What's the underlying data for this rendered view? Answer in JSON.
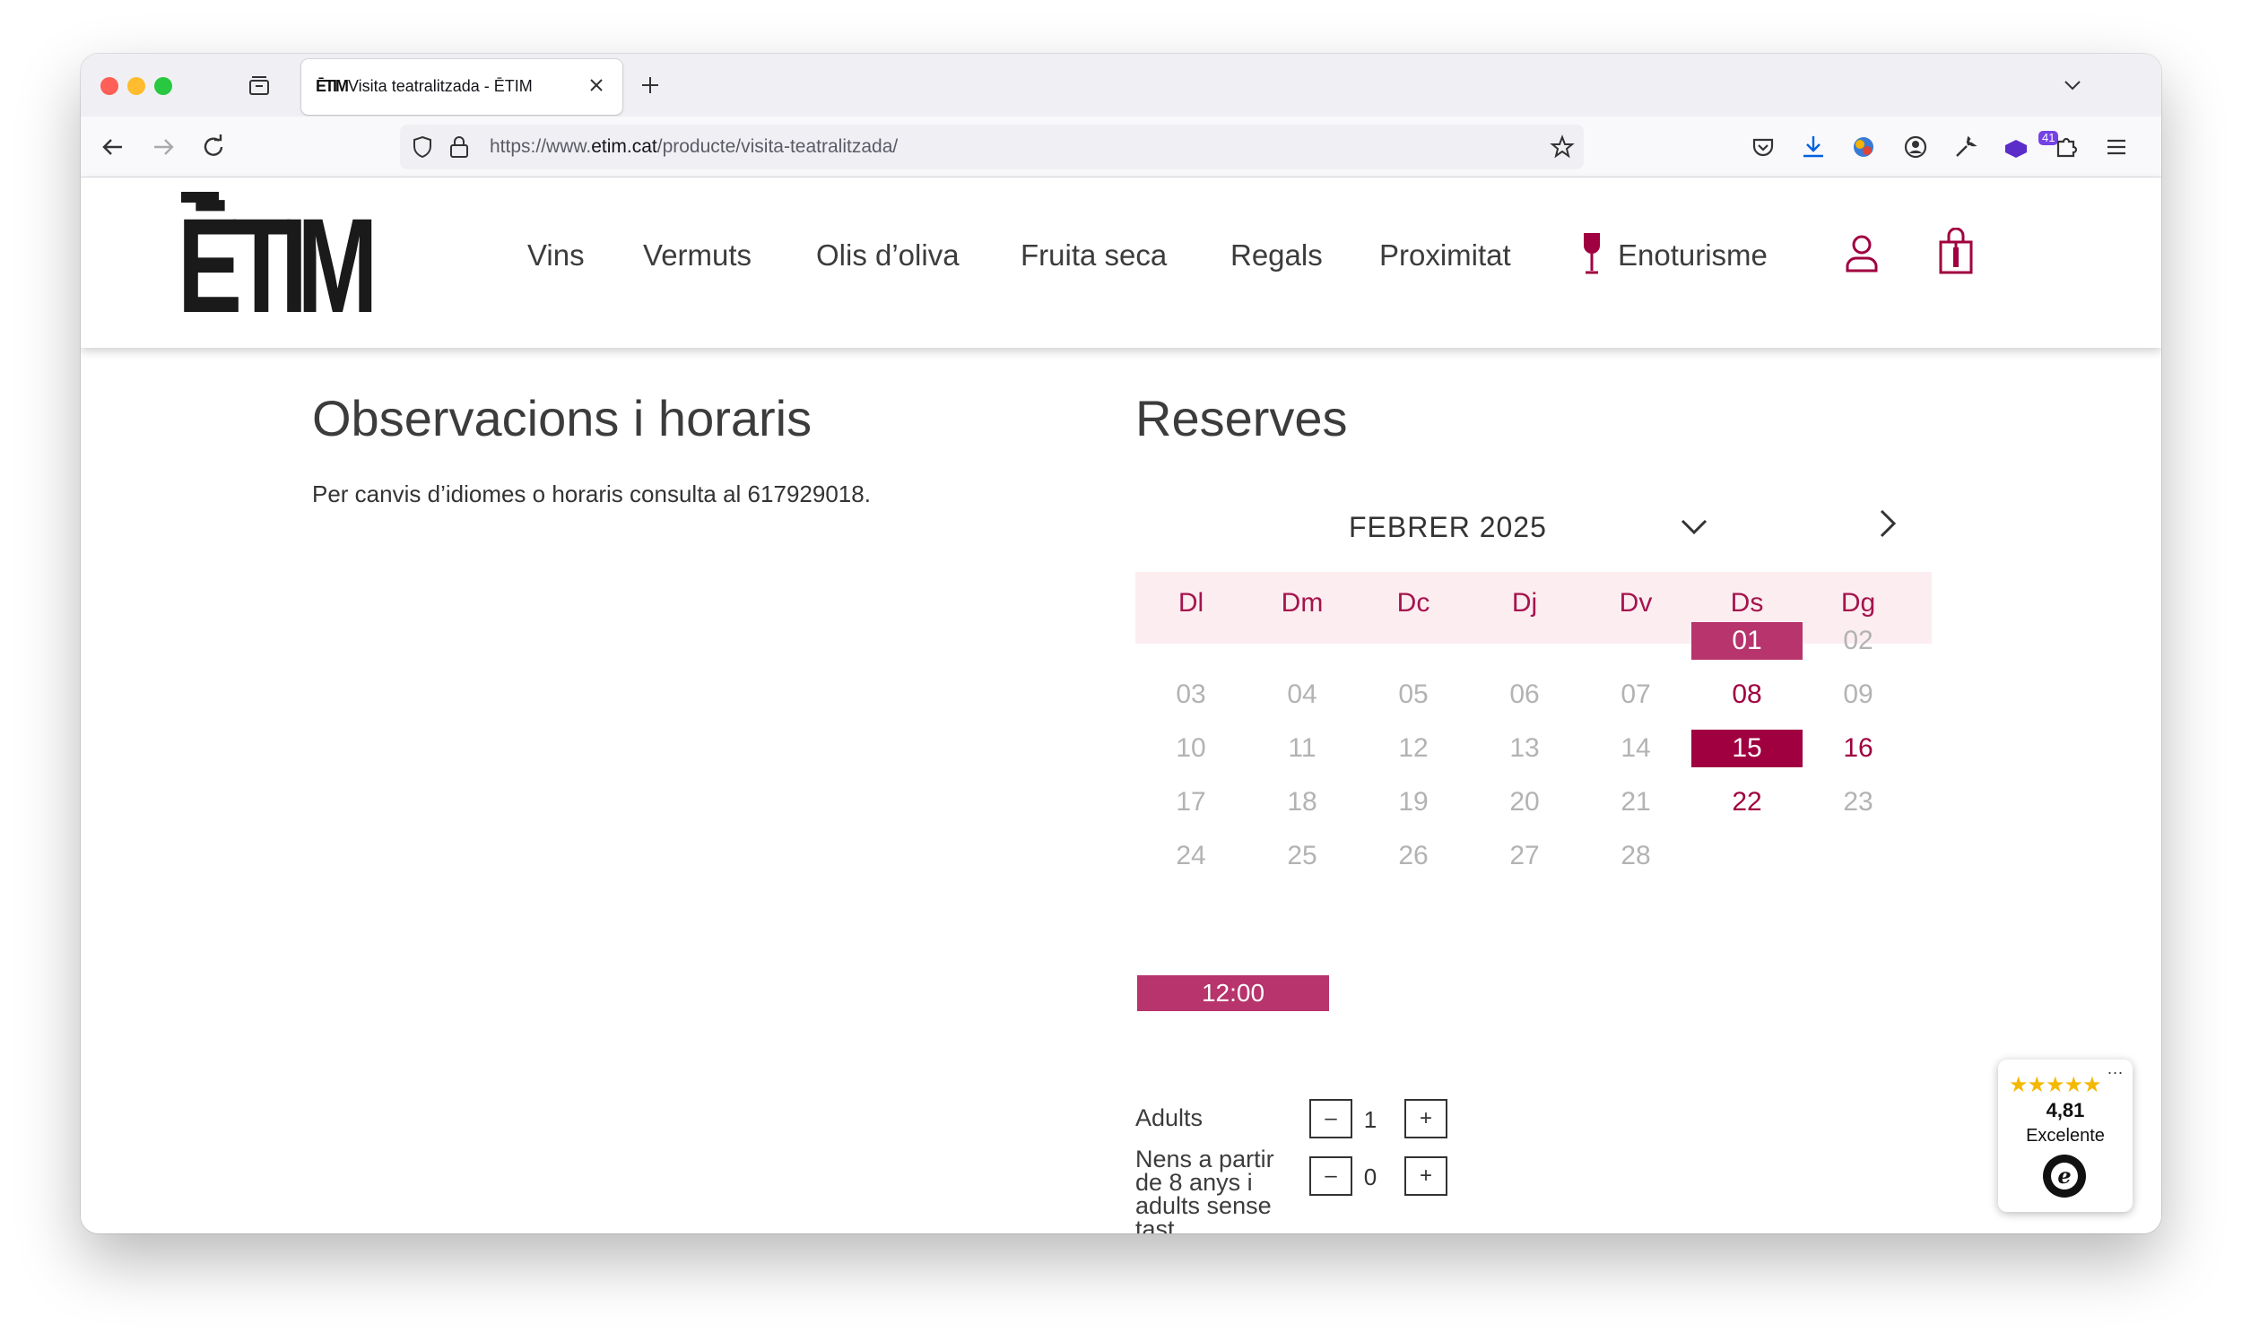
{
  "browser": {
    "tab": {
      "favicon": "ĒTIM",
      "title": "Visita teatralitzada - ĒTIM"
    },
    "url": {
      "prefix": "https://www.",
      "domain": "etim.cat",
      "path": "/producte/visita-teatralitzada/"
    },
    "extension_badge": "41"
  },
  "site": {
    "logo": "ĒTIM",
    "nav": [
      "Vins",
      "Vermuts",
      "Olis d’oliva",
      "Fruita seca",
      "Regals",
      "Proximitat",
      "Enoturisme"
    ]
  },
  "observations": {
    "title": "Observacions i horaris",
    "text": "Per canvis d’idiomes o horaris consulta al 617929018."
  },
  "reservations": {
    "title": "Reserves",
    "month": "FEBRER 2025",
    "weekdays": [
      "Dl",
      "Dm",
      "Dc",
      "Dj",
      "Dv",
      "Ds",
      "Dg"
    ],
    "weeks": [
      [
        "",
        "",
        "",
        "",
        "",
        "01",
        "02"
      ],
      [
        "03",
        "04",
        "05",
        "06",
        "07",
        "08",
        "09"
      ],
      [
        "10",
        "11",
        "12",
        "13",
        "14",
        "15",
        "16"
      ],
      [
        "17",
        "18",
        "19",
        "20",
        "21",
        "22",
        "23"
      ],
      [
        "24",
        "25",
        "26",
        "27",
        "28",
        "",
        ""
      ]
    ],
    "selected_day": "01",
    "today_day": "15",
    "available_days": [
      "08",
      "16",
      "22"
    ],
    "time_slot": "12:00",
    "adults": {
      "label": "Adults",
      "value": "1",
      "minus": "–",
      "plus": "+"
    },
    "children": {
      "label_lines": [
        "Nens a partir",
        "de 8 anys i",
        "adults sense",
        "tast"
      ],
      "value": "0",
      "minus": "–",
      "plus": "+"
    }
  },
  "trust_badge": {
    "stars": "★★★★★",
    "score": "4,81",
    "label": "Excelente",
    "menu": "..."
  },
  "colors": {
    "brand": "#a0003f",
    "selected": "#b7346c",
    "header_bg": "#fcedf1"
  }
}
